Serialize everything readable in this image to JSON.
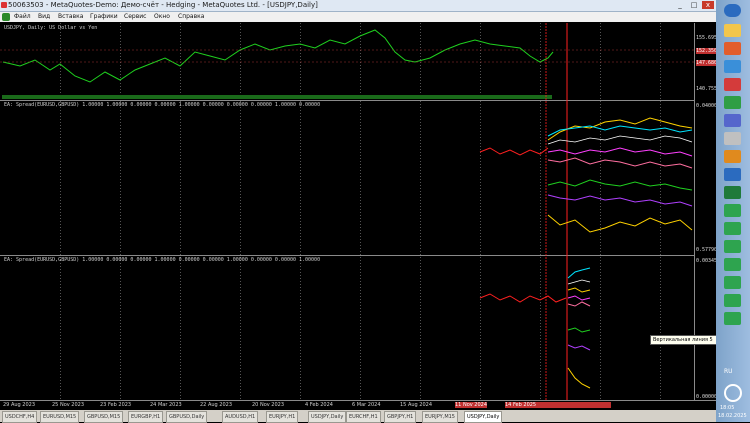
{
  "window": {
    "title": "50063503 - MetaQuotes-Demo: Демо-счёт - Hedging - MetaQuotes Ltd. - [USDJPY,Daily]",
    "minimize": "_",
    "maximize": "□",
    "close": "x"
  },
  "menu": {
    "items": [
      "Файл",
      "Вид",
      "Вставка",
      "Графики",
      "Сервис",
      "Окно",
      "Справка"
    ]
  },
  "chart": {
    "main_label": "USDJPY, Daily:  US Dollar vs Yen",
    "indicator1_label": "EA: Spread(EURUSD,GBPUSD)  1.00000  1.00000  0.00000  0.00000  1.00000  0.00000  0.00000  0.00000  1.00000  0.00000",
    "indicator2_label": "EA: Spread(EURUSD,GBPUSD)  1.00000  0.00000  0.00000  1.00000  0.00000  0.00000  1.00000  0.00000  0.00000  1.00000",
    "price_labels_main": [
      "155.695",
      "152.350",
      "147.680",
      "140.755"
    ],
    "price_labels_ind1": [
      "0.04000",
      "0.57790"
    ],
    "price_labels_ind2": [
      "0.00345",
      "0.00000"
    ],
    "tooltip": "Вертикальная линия 5",
    "colors": {
      "main_line": "#1fd01f",
      "red": "#ff2020",
      "yellow": "#ffd200",
      "cyan": "#00e5ff",
      "magenta": "#ff40ff",
      "green": "#20d020",
      "white": "#ffffff",
      "pink": "#ff6fa0"
    }
  },
  "time_axis": {
    "labels": [
      "29 Aug 2023",
      "25 Nov 2023",
      "23 Feb 2023",
      "24 Mar 2023",
      "22 Aug 2023",
      "20 Nov 2023",
      "4 Feb 2024",
      "6 Mar 2024",
      "15 Aug 2024",
      "11 Nov 2024",
      "14 Feb 2025"
    ]
  },
  "tabs": [
    "USDCHF,H4",
    "EURUSD,M15",
    "GBPUSD,M15",
    "EURGBP,H1",
    "GBPUSD,Daily",
    "AUDUSD,H1",
    "EURJPY,H1",
    "USDJPY,Daily",
    "EURCHF,H1",
    "GBPJPY,H1",
    "EURJPY,M15",
    "USDJPY,Daily"
  ],
  "taskbar": {
    "lang": "RU",
    "time": "18:05",
    "date": "18.02.2025"
  }
}
